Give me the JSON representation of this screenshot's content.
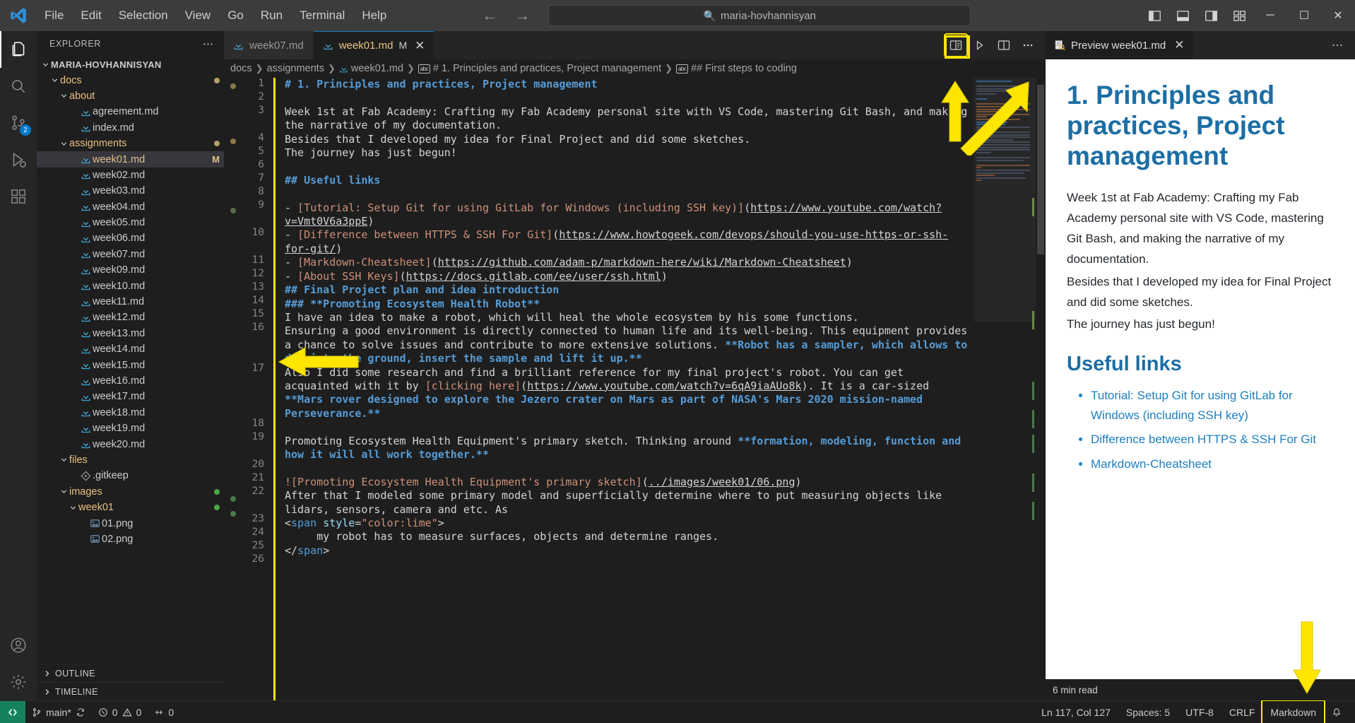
{
  "titlebar": {
    "menus": [
      "File",
      "Edit",
      "Selection",
      "View",
      "Go",
      "Run",
      "Terminal",
      "Help"
    ],
    "back_icon": "arrow-left-icon",
    "forward_icon": "arrow-right-icon",
    "search_value": "maria-hovhannisyan",
    "search_icon": "search-icon",
    "layout_icons": [
      "toggle-primary-sidebar-icon",
      "toggle-panel-icon",
      "toggle-secondary-sidebar-icon",
      "customize-layout-icon"
    ],
    "window_controls": {
      "minimize": "─",
      "maximize": "☐",
      "close": "✕"
    }
  },
  "activitybar": {
    "items": [
      {
        "name": "explorer",
        "icon": "files-icon",
        "badge": ""
      },
      {
        "name": "search",
        "icon": "search-icon",
        "badge": ""
      },
      {
        "name": "source-control",
        "icon": "source-control-icon",
        "badge": "2"
      },
      {
        "name": "run-and-debug",
        "icon": "debug-icon",
        "badge": ""
      },
      {
        "name": "extensions",
        "icon": "extensions-icon",
        "badge": ""
      }
    ],
    "bottom": [
      {
        "name": "accounts",
        "icon": "account-icon"
      },
      {
        "name": "manage",
        "icon": "gear-icon"
      }
    ]
  },
  "sidebar": {
    "title": "EXPLORER",
    "more_actions": "⋯",
    "root": "MARIA-HOVHANNISYAN",
    "tree": [
      {
        "label": "MARIA-HOVHANNISYAN",
        "type": "root",
        "indent": 0,
        "expanded": true
      },
      {
        "label": "docs",
        "type": "folder",
        "indent": 1,
        "expanded": true,
        "modified": true
      },
      {
        "label": "about",
        "type": "folder",
        "indent": 2,
        "expanded": true
      },
      {
        "label": "agreement.md",
        "type": "md",
        "indent": 3
      },
      {
        "label": "index.md",
        "type": "md",
        "indent": 3
      },
      {
        "label": "assignments",
        "type": "folder",
        "indent": 2,
        "expanded": true,
        "modified": true
      },
      {
        "label": "week01.md",
        "type": "md",
        "indent": 3,
        "selected": true,
        "badge": "M"
      },
      {
        "label": "week02.md",
        "type": "md",
        "indent": 3
      },
      {
        "label": "week03.md",
        "type": "md",
        "indent": 3
      },
      {
        "label": "week04.md",
        "type": "md",
        "indent": 3
      },
      {
        "label": "week05.md",
        "type": "md",
        "indent": 3
      },
      {
        "label": "week06.md",
        "type": "md",
        "indent": 3
      },
      {
        "label": "week07.md",
        "type": "md",
        "indent": 3
      },
      {
        "label": "week09.md",
        "type": "md",
        "indent": 3
      },
      {
        "label": "week10.md",
        "type": "md",
        "indent": 3
      },
      {
        "label": "week11.md",
        "type": "md",
        "indent": 3
      },
      {
        "label": "week12.md",
        "type": "md",
        "indent": 3
      },
      {
        "label": "week13.md",
        "type": "md",
        "indent": 3
      },
      {
        "label": "week14.md",
        "type": "md",
        "indent": 3
      },
      {
        "label": "week15.md",
        "type": "md",
        "indent": 3
      },
      {
        "label": "week16.md",
        "type": "md",
        "indent": 3
      },
      {
        "label": "week17.md",
        "type": "md",
        "indent": 3
      },
      {
        "label": "week18.md",
        "type": "md",
        "indent": 3
      },
      {
        "label": "week19.md",
        "type": "md",
        "indent": 3
      },
      {
        "label": "week20.md",
        "type": "md",
        "indent": 3
      },
      {
        "label": "files",
        "type": "folder",
        "indent": 2,
        "expanded": true
      },
      {
        "label": ".gitkeep",
        "type": "git",
        "indent": 3
      },
      {
        "label": "images",
        "type": "folder",
        "indent": 2,
        "expanded": true,
        "modified": true
      },
      {
        "label": "week01",
        "type": "folder",
        "indent": 3,
        "expanded": true,
        "modified": true
      },
      {
        "label": "01.png",
        "type": "png",
        "indent": 4
      },
      {
        "label": "02.png",
        "type": "png",
        "indent": 4
      }
    ],
    "sections": [
      {
        "label": "OUTLINE"
      },
      {
        "label": "TIMELINE"
      }
    ]
  },
  "editor": {
    "tabs": [
      {
        "label": "week07.md",
        "active": false,
        "modified": false,
        "icon": "markdown-file-icon"
      },
      {
        "label": "week01.md",
        "active": true,
        "modified": true,
        "modified_mark": "M",
        "icon": "markdown-file-icon",
        "close": "✕"
      }
    ],
    "actions": [
      {
        "name": "open-preview-to-side",
        "icon": "preview-side-icon",
        "highlighted": true
      },
      {
        "name": "run-code",
        "icon": "run-icon"
      },
      {
        "name": "split-editor",
        "icon": "split-editor-icon"
      },
      {
        "name": "more-actions",
        "icon": "ellipsis-icon"
      }
    ],
    "breadcrumb": [
      {
        "label": "docs",
        "icon": ""
      },
      {
        "label": "assignments",
        "icon": ""
      },
      {
        "label": "week01.md",
        "icon": "markdown-file-icon"
      },
      {
        "label": "# 1. Principles and practices, Project management",
        "icon": "symbol-string-icon"
      },
      {
        "label": "## First steps to coding",
        "icon": "symbol-string-icon"
      }
    ],
    "lines": [
      {
        "n": "1",
        "seg": [
          {
            "t": "# 1. Principles and practices, Project management",
            "c": "head"
          }
        ]
      },
      {
        "n": "2",
        "seg": []
      },
      {
        "n": "3",
        "seg": [
          {
            "t": "Week 1st at Fab Academy: Crafting my Fab Academy personal site with VS Code, mastering Git Bash, and making the narrative of my documentation.",
            "c": "text"
          }
        ]
      },
      {
        "n": "4",
        "seg": [
          {
            "t": "Besides that I developed my idea for Final Project and did some sketches.",
            "c": "text"
          }
        ]
      },
      {
        "n": "5",
        "seg": [
          {
            "t": "The journey has just begun!",
            "c": "text"
          }
        ]
      },
      {
        "n": "6",
        "seg": []
      },
      {
        "n": "7",
        "seg": [
          {
            "t": "## Useful links",
            "c": "head"
          }
        ]
      },
      {
        "n": "8",
        "seg": []
      },
      {
        "n": "9",
        "seg": [
          {
            "t": "- ",
            "c": "punct"
          },
          {
            "t": "[Tutorial: Setup Git for using GitLab for Windows (including SSH key)]",
            "c": "link"
          },
          {
            "t": "(",
            "c": "punct"
          },
          {
            "t": "https://www.youtube.com/watch?v=Vmt0V6a3ppE",
            "c": "url"
          },
          {
            "t": ")",
            "c": "punct"
          }
        ]
      },
      {
        "n": "10",
        "seg": [
          {
            "t": "- ",
            "c": "punct"
          },
          {
            "t": "[Difference between HTTPS & SSH For Git]",
            "c": "link"
          },
          {
            "t": "(",
            "c": "punct"
          },
          {
            "t": "https://www.howtogeek.com/devops/should-you-use-https-or-ssh-for-git/",
            "c": "url"
          },
          {
            "t": ")",
            "c": "punct"
          }
        ]
      },
      {
        "n": "11",
        "seg": [
          {
            "t": "- ",
            "c": "punct"
          },
          {
            "t": "[Markdown-Cheatsheet]",
            "c": "link"
          },
          {
            "t": "(",
            "c": "punct"
          },
          {
            "t": "https://github.com/adam-p/markdown-here/wiki/Markdown-Cheatsheet",
            "c": "url"
          },
          {
            "t": ")",
            "c": "punct"
          }
        ]
      },
      {
        "n": "12",
        "seg": [
          {
            "t": "- ",
            "c": "punct"
          },
          {
            "t": "[About SSH Keys]",
            "c": "link"
          },
          {
            "t": "(",
            "c": "punct"
          },
          {
            "t": "https://docs.gitlab.com/ee/user/ssh.html",
            "c": "url"
          },
          {
            "t": ")",
            "c": "punct"
          }
        ]
      },
      {
        "n": "13",
        "seg": [
          {
            "t": "## Final Project plan and idea introduction",
            "c": "head"
          }
        ]
      },
      {
        "n": "14",
        "seg": [
          {
            "t": "### **Promoting Ecosystem Health Robot**",
            "c": "head"
          }
        ]
      },
      {
        "n": "15",
        "seg": [
          {
            "t": "I have an idea to make a robot, which will heal the whole ecosystem by his some functions.",
            "c": "text"
          }
        ]
      },
      {
        "n": "16",
        "seg": [
          {
            "t": "Ensuring a good environment is directly connected to human life and its well-being. This equipment provides a chance to solve issues and contribute to more extensive solutions. ",
            "c": "text"
          },
          {
            "t": "**Robot has a sampler, which allows to dig into the ground, insert the sample and lift it up.**",
            "c": "bold"
          }
        ]
      },
      {
        "n": "17",
        "seg": [
          {
            "t": "Also I did some research and find a brilliant reference for my final project's robot. You can get acquainted with it by ",
            "c": "text"
          },
          {
            "t": "[clicking here]",
            "c": "link"
          },
          {
            "t": "(",
            "c": "punct"
          },
          {
            "t": "https://www.youtube.com/watch?v=6qA9iaAUo8k",
            "c": "url"
          },
          {
            "t": "). ",
            "c": "punct"
          },
          {
            "t": "It is a car-sized ",
            "c": "text"
          },
          {
            "t": "**Mars rover designed to explore the Jezero crater on Mars as part of NASA's Mars 2020 mission-named Perseverance.**",
            "c": "bold"
          }
        ]
      },
      {
        "n": "18",
        "seg": []
      },
      {
        "n": "19",
        "seg": [
          {
            "t": "Promoting Ecosystem Health Equipment's primary sketch. Thinking around ",
            "c": "text"
          },
          {
            "t": "**formation, modeling, function and how it will all work together.**",
            "c": "bold"
          }
        ]
      },
      {
        "n": "20",
        "seg": []
      },
      {
        "n": "21",
        "seg": [
          {
            "t": "![Promoting Ecosystem Health Equipment's primary sketch]",
            "c": "img"
          },
          {
            "t": "(",
            "c": "punct"
          },
          {
            "t": "../images/week01/06.png",
            "c": "url"
          },
          {
            "t": ")",
            "c": "punct"
          }
        ]
      },
      {
        "n": "22",
        "seg": [
          {
            "t": "After that I modeled some primary model and superficially determine where to put measuring objects like lidars, sensors, camera and etc. As",
            "c": "text"
          }
        ]
      },
      {
        "n": "23",
        "seg": [
          {
            "t": "<",
            "c": "punct"
          },
          {
            "t": "span",
            "c": "tag"
          },
          {
            "t": " ",
            "c": "punct"
          },
          {
            "t": "style",
            "c": "attr"
          },
          {
            "t": "=",
            "c": "punct"
          },
          {
            "t": "\"color:lime\"",
            "c": "str"
          },
          {
            "t": ">",
            "c": "punct"
          }
        ]
      },
      {
        "n": "24",
        "seg": [
          {
            "t": "     my robot has to measure surfaces, objects and determine ranges.",
            "c": "text"
          }
        ]
      },
      {
        "n": "25",
        "seg": [
          {
            "t": "</",
            "c": "punct"
          },
          {
            "t": "span",
            "c": "tag"
          },
          {
            "t": ">",
            "c": "punct"
          }
        ]
      },
      {
        "n": "26",
        "seg": []
      }
    ]
  },
  "preview": {
    "tab_label": "Preview week01.md",
    "tab_icon": "preview-icon",
    "close": "✕",
    "more": "⋯",
    "h1": "1. Principles and practices, Project management",
    "paragraphs": [
      "Week 1st at Fab Academy: Crafting my Fab Academy personal site with VS Code, mastering Git Bash, and making the narrative of my documentation.",
      "Besides that I developed my idea for Final Project and did some sketches.",
      "The journey has just begun!"
    ],
    "h2": "Useful links",
    "links": [
      "Tutorial: Setup Git for using GitLab for Windows (including SSH key)",
      "Difference between HTTPS & SSH For Git",
      "Markdown-Cheatsheet"
    ],
    "read_time": "6 min read"
  },
  "statusbar": {
    "remote_icon": "remote-window-icon",
    "branch": "main*",
    "branch_icon": "source-control-icon",
    "sync_icon": "sync-icon",
    "errors": "0",
    "warnings": "0",
    "ports": "0",
    "position": "Ln 117, Col 127",
    "spaces": "Spaces: 5",
    "encoding": "UTF-8",
    "eol": "CRLF",
    "language": "Markdown",
    "bell_icon": "bell-icon"
  },
  "colors": {
    "accent": "#0f7ac4",
    "highlight": "#ffe600",
    "modified": "#e2c08d",
    "heading_blue": "#569cd6",
    "link_orange": "#ce9178",
    "preview_heading": "#1c6ea4",
    "preview_link": "#1e7fc0",
    "git_green": "#16825d"
  }
}
